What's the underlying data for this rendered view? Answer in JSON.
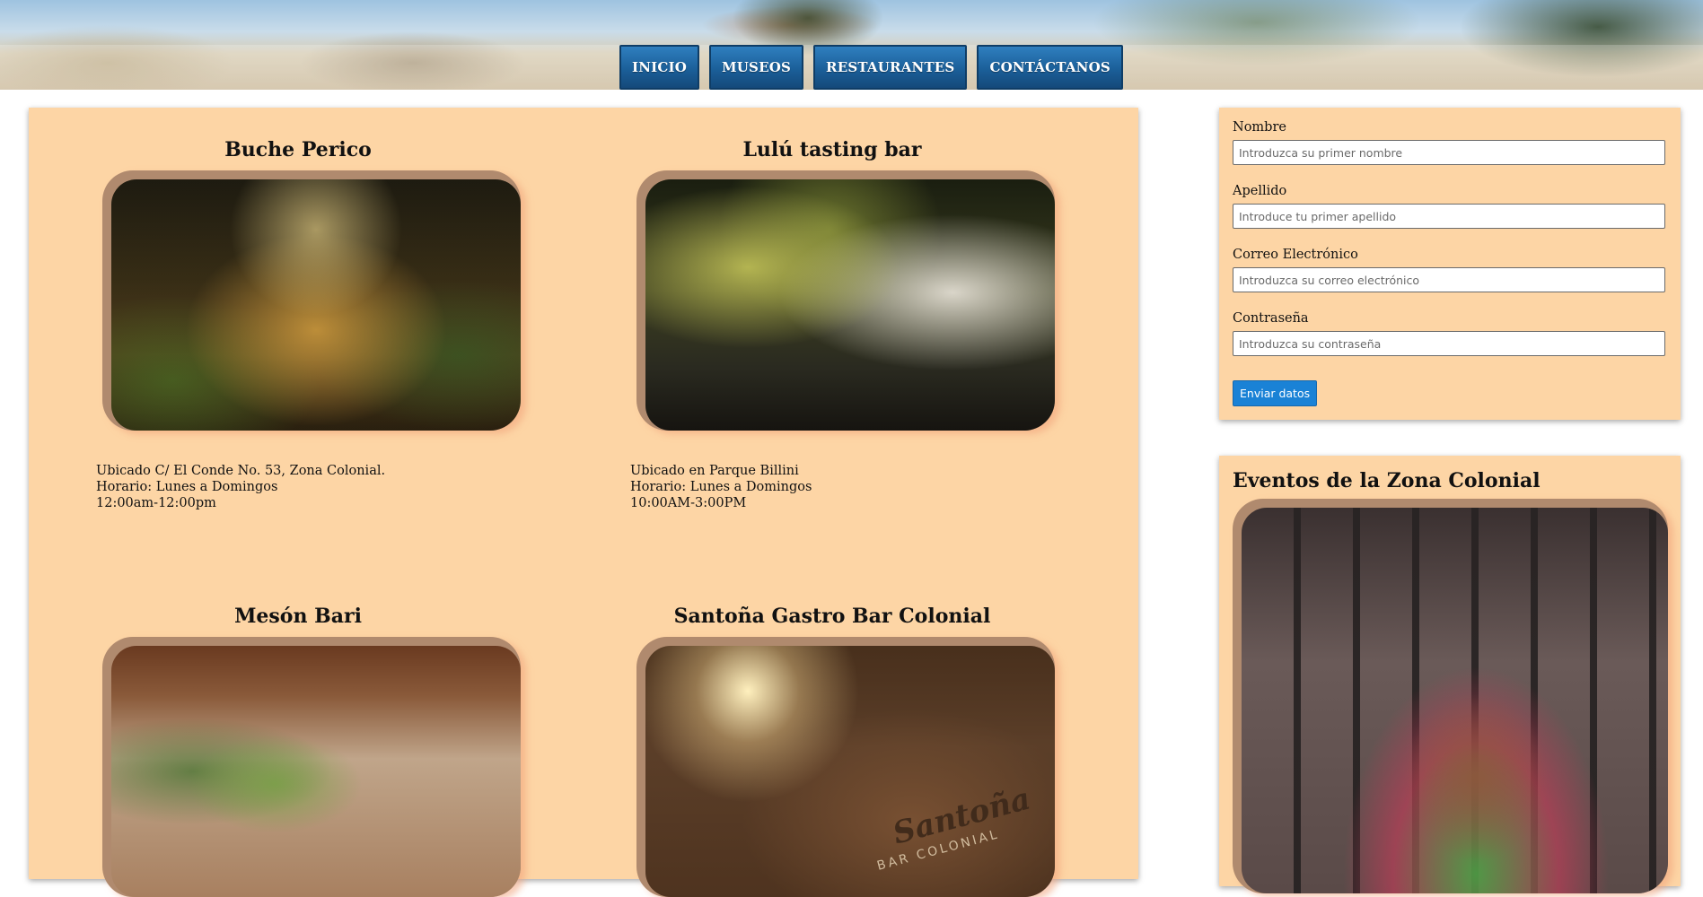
{
  "nav": {
    "items": [
      {
        "label": "INICIO"
      },
      {
        "label": "MUSEOS"
      },
      {
        "label": "RESTAURANTES"
      },
      {
        "label": "CONTÁCTANOS"
      }
    ]
  },
  "restaurants": [
    {
      "name": "Buche Perico",
      "line1": "Ubicado C/ El Conde No. 53, Zona Colonial.",
      "line2": "Horario: Lunes a Domingos",
      "line3": "12:00am-12:00pm"
    },
    {
      "name": "Lulú tasting bar",
      "line1": "Ubicado en Parque Billini",
      "line2": "Horario: Lunes a Domingos",
      "line3": "10:00AM-3:00PM"
    },
    {
      "name": "Mesón Bari"
    },
    {
      "name": "Santoña Gastro Bar Colonial",
      "sign_text": "Santoña",
      "sign_subtext": "BAR COLONIAL"
    }
  ],
  "form": {
    "first_name_label": "Nombre",
    "first_name_placeholder": "Introduzca su primer nombre",
    "last_name_label": "Apellido",
    "last_name_placeholder": "Introduce tu primer apellido",
    "email_label": "Correo Electrónico",
    "email_placeholder": "Introduzca su correo electrónico",
    "password_label": "Contraseña",
    "password_placeholder": "Introduzca su contraseña",
    "submit_label": "Enviar datos"
  },
  "events": {
    "title": "Eventos de la Zona Colonial"
  },
  "colors": {
    "panel": "#fdd5a5",
    "nav_button": "#1b5f99",
    "submit_button": "#1a82d6"
  }
}
